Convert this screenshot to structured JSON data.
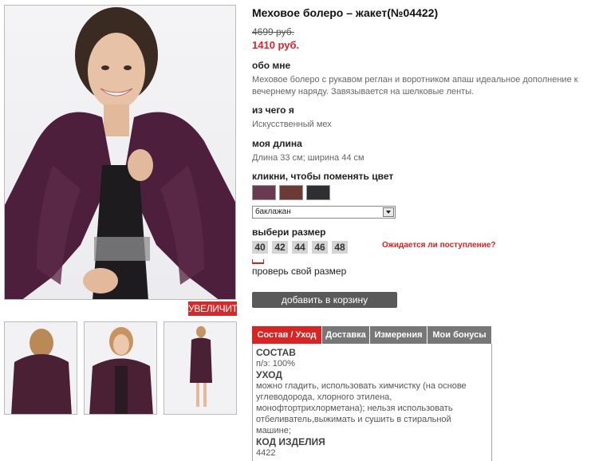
{
  "product": {
    "title": "Меховое болеро – жакет(№04422)",
    "old_price": "4699 руб.",
    "new_price": "1410 руб."
  },
  "gallery": {
    "zoom_label": "УВЕЛИЧИТЬ",
    "thumbnails": [
      "back-view-photo",
      "front-view-photo",
      "full-length-photo"
    ]
  },
  "sections": {
    "about": {
      "heading": "обо мне",
      "text": "Меховое болеро с рукавом реглан и воротником апаш идеальное дополнение к вечернему наряду. Завязывается на шелковые ленты."
    },
    "material": {
      "heading": "из чего я",
      "text": "Искусственный мех"
    },
    "length": {
      "heading": "моя длина",
      "text": "Длина 33 см; ширина 44 см"
    },
    "color": {
      "heading": "кликни, чтобы поменять цвет",
      "selected": "баклажан",
      "swatches": [
        "#6a3a52",
        "#6b3a34",
        "#2e2e33"
      ]
    },
    "size": {
      "heading": "выбери размер",
      "options": [
        "40",
        "42",
        "44",
        "46",
        "48"
      ],
      "await_link": "Ожидается ли поступление?",
      "size_check": "проверь свой размер"
    }
  },
  "cart": {
    "button_label": "добавить в корзину"
  },
  "tabs": {
    "items": [
      "Состав / Уход",
      "Доставка",
      "Измерения",
      "Мои бонусы"
    ],
    "active": 0,
    "panel": {
      "composition_heading": "СОСТАВ",
      "composition_text": "п/э: 100%",
      "care_heading": "УХОД",
      "care_text": "можно гладить, использовать химчистку (на основе углеводорода, хлорного этилена, монофтортрихлорметана); нельзя использовать отбеливатель,выжимать и сушить в стиральной машине;",
      "code_heading": "КОД ИЗДЕЛИЯ",
      "code_value": "4422"
    }
  },
  "colors": {
    "accent": "#d32b2b",
    "tab_inactive": "#777777",
    "button": "#5a5a5a"
  }
}
